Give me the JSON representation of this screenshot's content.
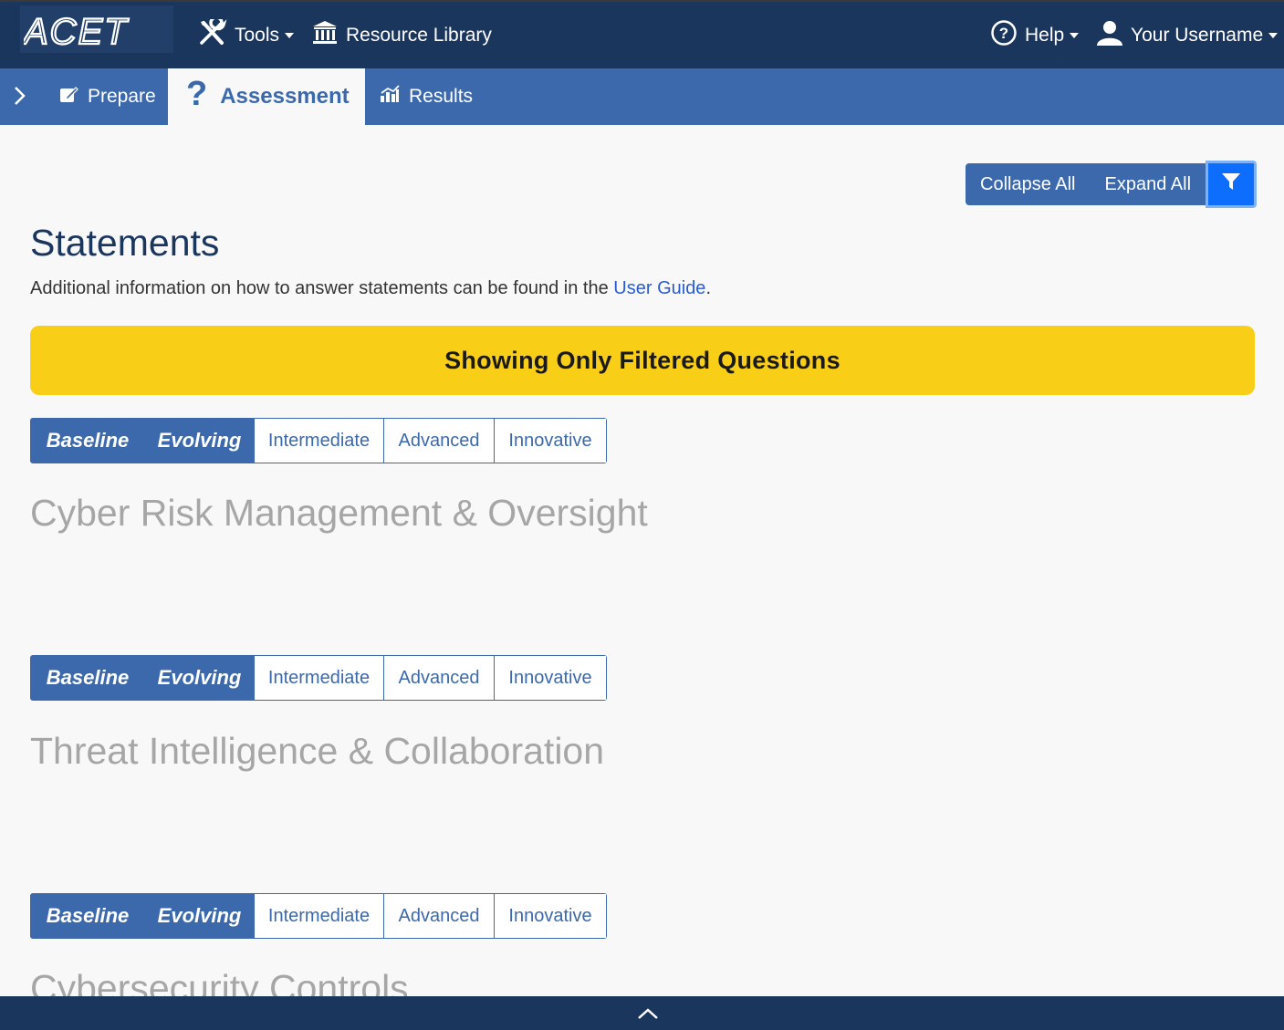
{
  "app": {
    "name": "ACET"
  },
  "topnav": {
    "tools": "Tools",
    "resource_library": "Resource Library",
    "help": "Help",
    "user": "Your Username"
  },
  "subnav": {
    "tabs": [
      {
        "label": "Prepare"
      },
      {
        "label": "Assessment",
        "active": true
      },
      {
        "label": "Results"
      }
    ]
  },
  "toolbar": {
    "collapse_all": "Collapse All",
    "expand_all": "Expand All",
    "filter_icon": "filter-icon"
  },
  "page": {
    "title": "Statements",
    "intro_prefix": "Additional information on how to answer statements can be found in the ",
    "intro_link": "User Guide",
    "intro_suffix": ".",
    "banner": "Showing Only Filtered Questions"
  },
  "maturity_levels": [
    "Baseline",
    "Evolving",
    "Intermediate",
    "Advanced",
    "Innovative"
  ],
  "selected_levels": [
    "Baseline",
    "Evolving"
  ],
  "domains": [
    {
      "title": "Cyber Risk Management & Oversight"
    },
    {
      "title": "Threat Intelligence & Collaboration"
    },
    {
      "title": "Cybersecurity Controls"
    }
  ],
  "colors": {
    "primary_dark": "#1b365d",
    "primary": "#3c69ab",
    "banner": "#f9ce16",
    "filter": "#0d6efd"
  }
}
